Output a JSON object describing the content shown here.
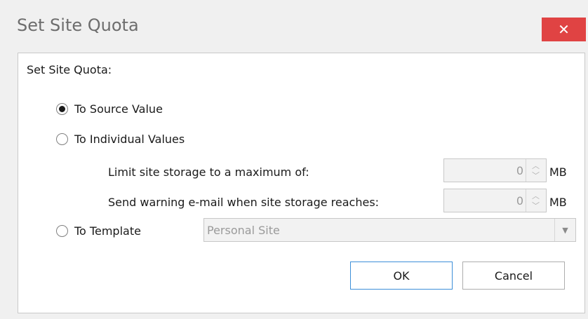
{
  "window": {
    "title": "Set Site Quota",
    "close_glyph": "✕"
  },
  "form": {
    "header": "Set Site Quota:",
    "options": {
      "source": "To Source Value",
      "individual": "To Individual Values",
      "template": "To Template"
    },
    "selected_option": "source",
    "limit": {
      "label": "Limit site storage to a maximum of:",
      "value": "0",
      "unit": "MB"
    },
    "warning": {
      "label": "Send warning e-mail when site storage reaches:",
      "value": "0",
      "unit": "MB"
    },
    "template_select": {
      "value": "Personal Site"
    }
  },
  "buttons": {
    "ok": "OK",
    "cancel": "Cancel"
  },
  "icons": {
    "close": "close-icon",
    "spin_up": "chevron-up-icon",
    "spin_down": "chevron-down-icon",
    "combo": "dropdown-arrow-icon"
  }
}
